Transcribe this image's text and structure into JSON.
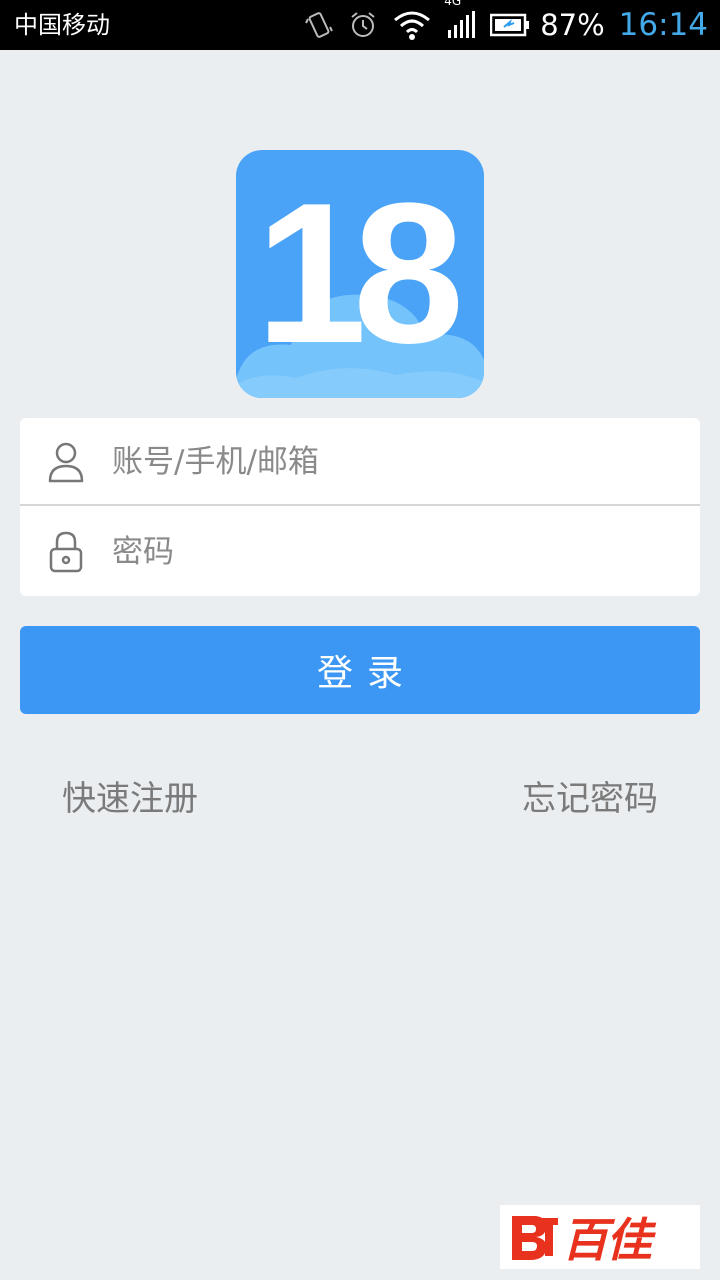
{
  "status_bar": {
    "carrier": "中国移动",
    "network": "4G",
    "battery_percent": "87%",
    "time": "16:14",
    "icons": [
      "vibrate-icon",
      "alarm-icon",
      "wifi-icon",
      "signal-icon",
      "battery-icon"
    ],
    "clock_color": "#44a9e8"
  },
  "logo": {
    "text": "18",
    "bg_color": "#4aa3f7",
    "cloud_color": "#74c3fb"
  },
  "form": {
    "account_placeholder": "账号/手机/邮箱",
    "account_value": "",
    "password_placeholder": "密码",
    "password_value": "",
    "account_icon": "user-icon",
    "password_icon": "lock-icon"
  },
  "login_label": "登录",
  "links": {
    "register": "快速注册",
    "forgot": "忘记密码"
  },
  "watermark": {
    "text": "百佳"
  },
  "colors": {
    "background": "#eaeef0",
    "accent": "#3b97f3"
  }
}
